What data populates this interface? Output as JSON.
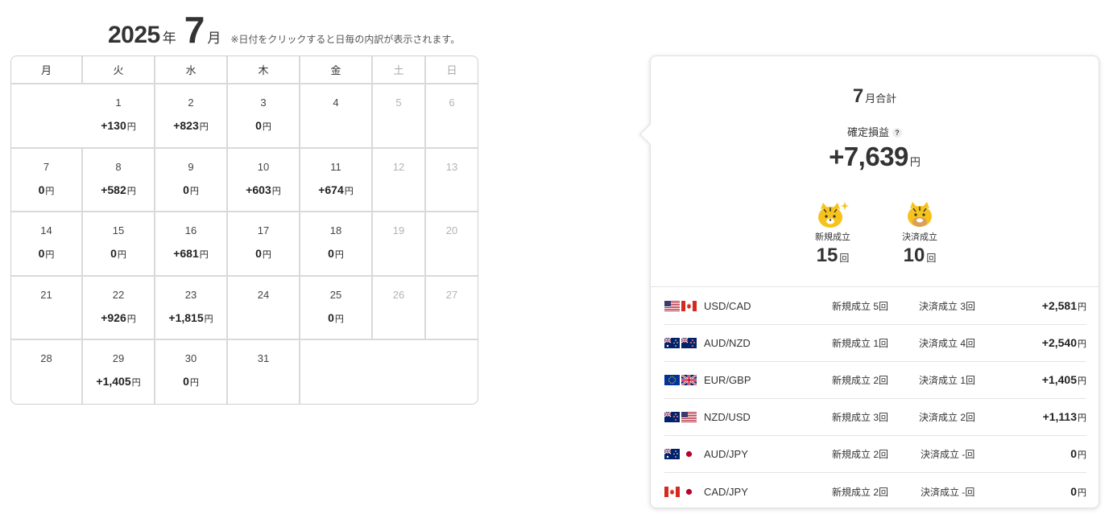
{
  "header": {
    "year": "2025",
    "year_unit": "年",
    "month": "7",
    "month_unit": "月",
    "note": "※日付をクリックすると日毎の内訳が表示されます。"
  },
  "calendar": {
    "weekdays": [
      "月",
      "火",
      "水",
      "木",
      "金",
      "土",
      "日"
    ],
    "yen": "円",
    "weeks": [
      [
        null,
        {
          "day": "1",
          "amount": "+130"
        },
        {
          "day": "2",
          "amount": "+823"
        },
        {
          "day": "3",
          "amount": "0"
        },
        {
          "day": "4",
          "amount": ""
        },
        {
          "day": "5",
          "amount": ""
        },
        {
          "day": "6",
          "amount": ""
        }
      ],
      [
        {
          "day": "7",
          "amount": "0"
        },
        {
          "day": "8",
          "amount": "+582"
        },
        {
          "day": "9",
          "amount": "0"
        },
        {
          "day": "10",
          "amount": "+603"
        },
        {
          "day": "11",
          "amount": "+674"
        },
        {
          "day": "12",
          "amount": ""
        },
        {
          "day": "13",
          "amount": ""
        }
      ],
      [
        {
          "day": "14",
          "amount": "0"
        },
        {
          "day": "15",
          "amount": "0"
        },
        {
          "day": "16",
          "amount": "+681"
        },
        {
          "day": "17",
          "amount": "0"
        },
        {
          "day": "18",
          "amount": "0"
        },
        {
          "day": "19",
          "amount": ""
        },
        {
          "day": "20",
          "amount": ""
        }
      ],
      [
        {
          "day": "21",
          "amount": ""
        },
        {
          "day": "22",
          "amount": "+926"
        },
        {
          "day": "23",
          "amount": "+1,815"
        },
        {
          "day": "24",
          "amount": ""
        },
        {
          "day": "25",
          "amount": "0"
        },
        {
          "day": "26",
          "amount": ""
        },
        {
          "day": "27",
          "amount": ""
        }
      ],
      [
        {
          "day": "28",
          "amount": ""
        },
        {
          "day": "29",
          "amount": "+1,405"
        },
        {
          "day": "30",
          "amount": "0"
        },
        {
          "day": "31",
          "amount": ""
        },
        null,
        null,
        null
      ]
    ]
  },
  "summary": {
    "month": "7",
    "month_total_label": "月合計",
    "realized_label": "確定損益",
    "help_icon": "?",
    "total": "+7,639",
    "yen": "円",
    "new_label": "新規成立",
    "new_count": "15",
    "settle_label": "決済成立",
    "settle_count": "10",
    "count_unit": "回",
    "mascot_color": "#f6c21c",
    "pairs": [
      {
        "flags": [
          "us",
          "ca"
        ],
        "name": "USD/CAD",
        "open": "新規成立 5回",
        "close": "決済成立 3回",
        "pl": "+2,581",
        "close_dash": false
      },
      {
        "flags": [
          "au",
          "nz"
        ],
        "name": "AUD/NZD",
        "open": "新規成立 1回",
        "close": "決済成立 4回",
        "pl": "+2,540",
        "close_dash": false
      },
      {
        "flags": [
          "eu",
          "gb"
        ],
        "name": "EUR/GBP",
        "open": "新規成立 2回",
        "close": "決済成立 1回",
        "pl": "+1,405",
        "close_dash": false
      },
      {
        "flags": [
          "nz",
          "us"
        ],
        "name": "NZD/USD",
        "open": "新規成立 3回",
        "close": "決済成立 2回",
        "pl": "+1,113",
        "close_dash": false
      },
      {
        "flags": [
          "au",
          "jp"
        ],
        "name": "AUD/JPY",
        "open": "新規成立 2回",
        "close": "決済成立 -回",
        "pl": "0",
        "close_dash": true
      },
      {
        "flags": [
          "ca",
          "jp"
        ],
        "name": "CAD/JPY",
        "open": "新規成立 2回",
        "close": "決済成立 -回",
        "pl": "0",
        "close_dash": true
      }
    ]
  }
}
